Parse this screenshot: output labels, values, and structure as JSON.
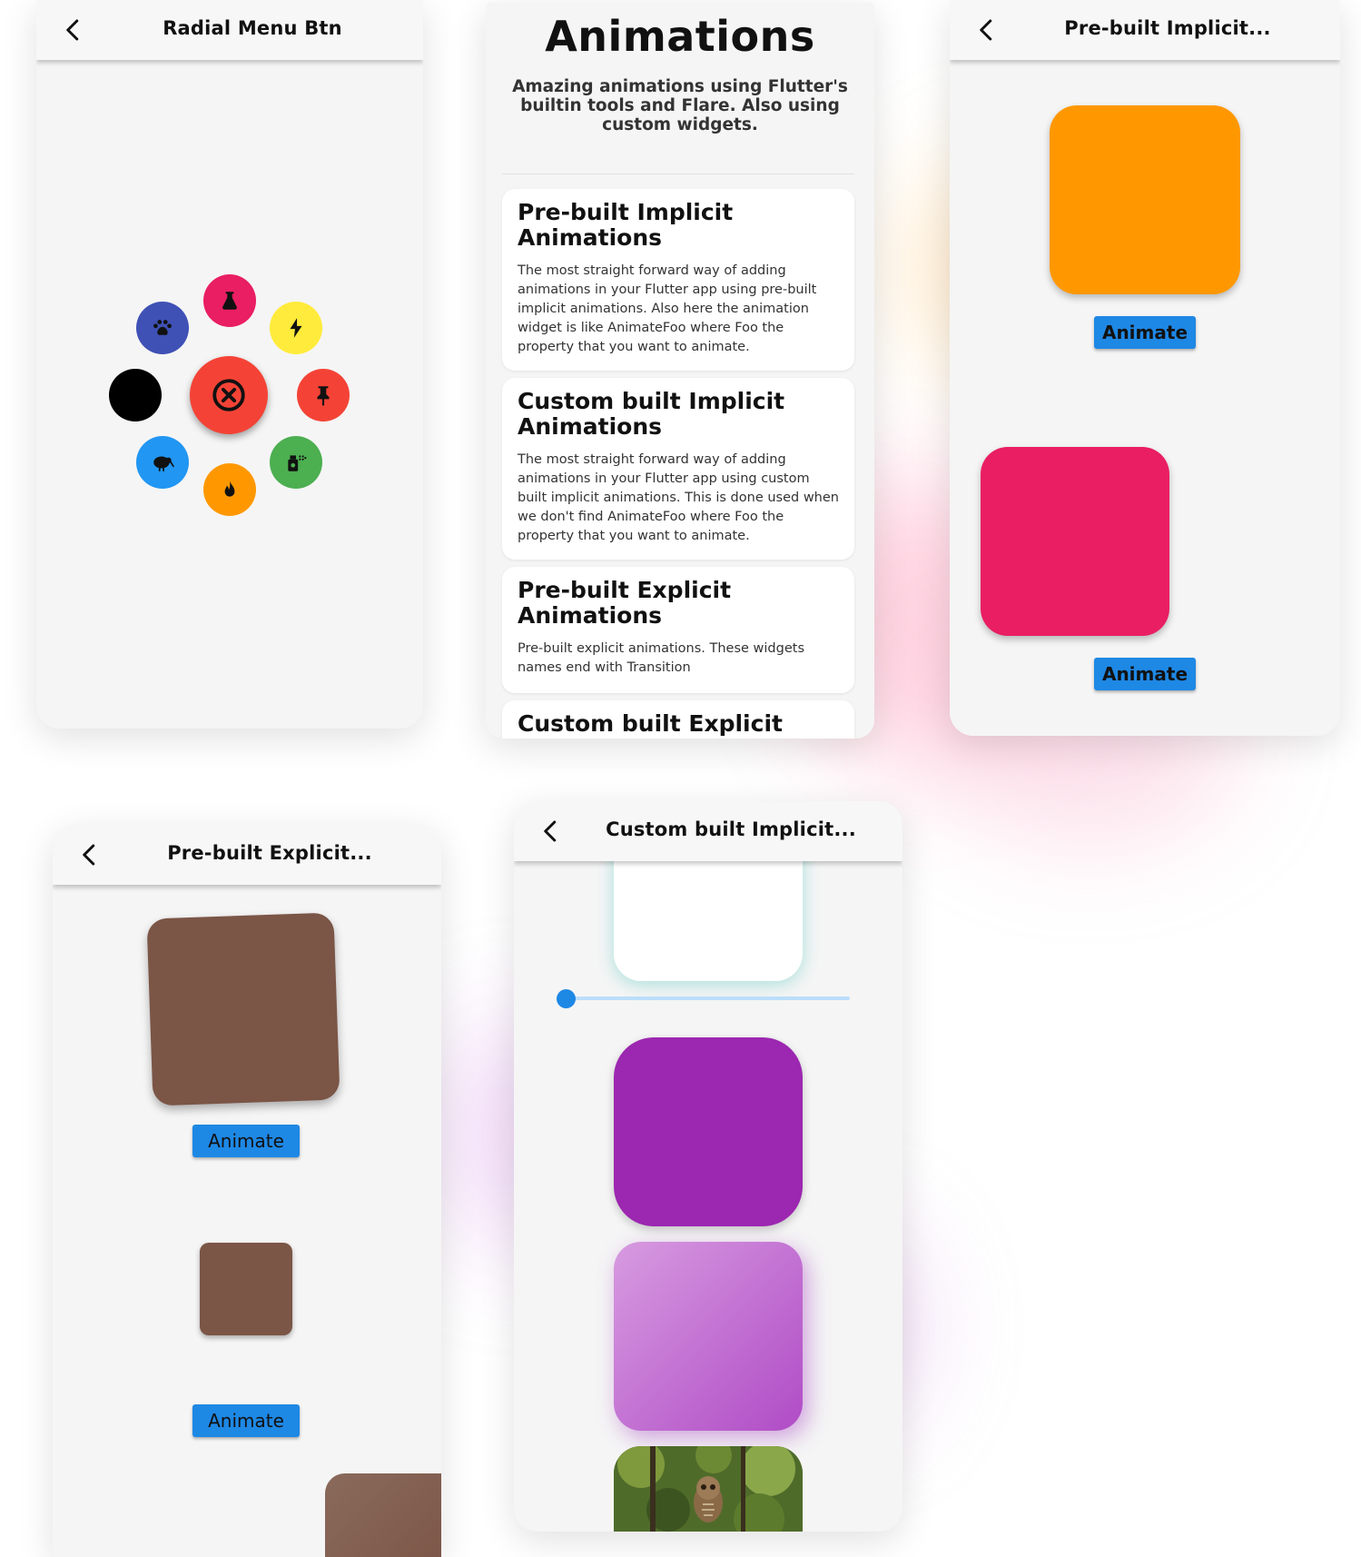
{
  "radial": {
    "title": "Radial Menu Btn",
    "colors": {
      "center": "#f44336",
      "science": "#e91e63",
      "bolt": "#ffeb3b",
      "pin": "#f44336",
      "spray": "#4caf50",
      "fire": "#ff9800",
      "kiwi": "#2196f3",
      "black": "#000000",
      "paw": "#3f51b5"
    }
  },
  "home": {
    "title": "Animations",
    "subtitle": "Amazing animations using Flutter's builtin tools and Flare. Also using custom widgets.",
    "cards": [
      {
        "title": "Pre-built Implicit Animations",
        "description": "The most straight forward way of adding animations in your Flutter app using pre-built implicit animations. Also here the animation widget is like AnimateFoo where Foo the property that you want to animate."
      },
      {
        "title": "Custom built Implicit Animations",
        "description": "The most straight forward way of adding animations in your Flutter app using custom built implicit animations. This is done used when we don't find AnimateFoo where Foo the property that you want to animate."
      },
      {
        "title": "Pre-built Explicit Animations",
        "description": "Pre-built explicit animations. These widgets names end with Transition"
      },
      {
        "title": "Custom built Explicit",
        "description": ""
      }
    ]
  },
  "implicit": {
    "title": "Pre-built Implicit...",
    "button1": "Animate",
    "button2": "Animate",
    "colors": {
      "box1": "#ff9800",
      "box2": "#e91e63",
      "button": "#1e88e5"
    }
  },
  "explicit": {
    "title": "Pre-built Explicit...",
    "button1": "Animate",
    "button2": "Animate",
    "colors": {
      "box": "#795548"
    }
  },
  "custom_implicit": {
    "title": "Custom built Implicit...",
    "slider_value": 0.0,
    "colors": {
      "box_white": "#ffffff",
      "box_purple": "#9c27b0",
      "box_light": "#ce93d8",
      "slider": "#1e88e5"
    }
  }
}
